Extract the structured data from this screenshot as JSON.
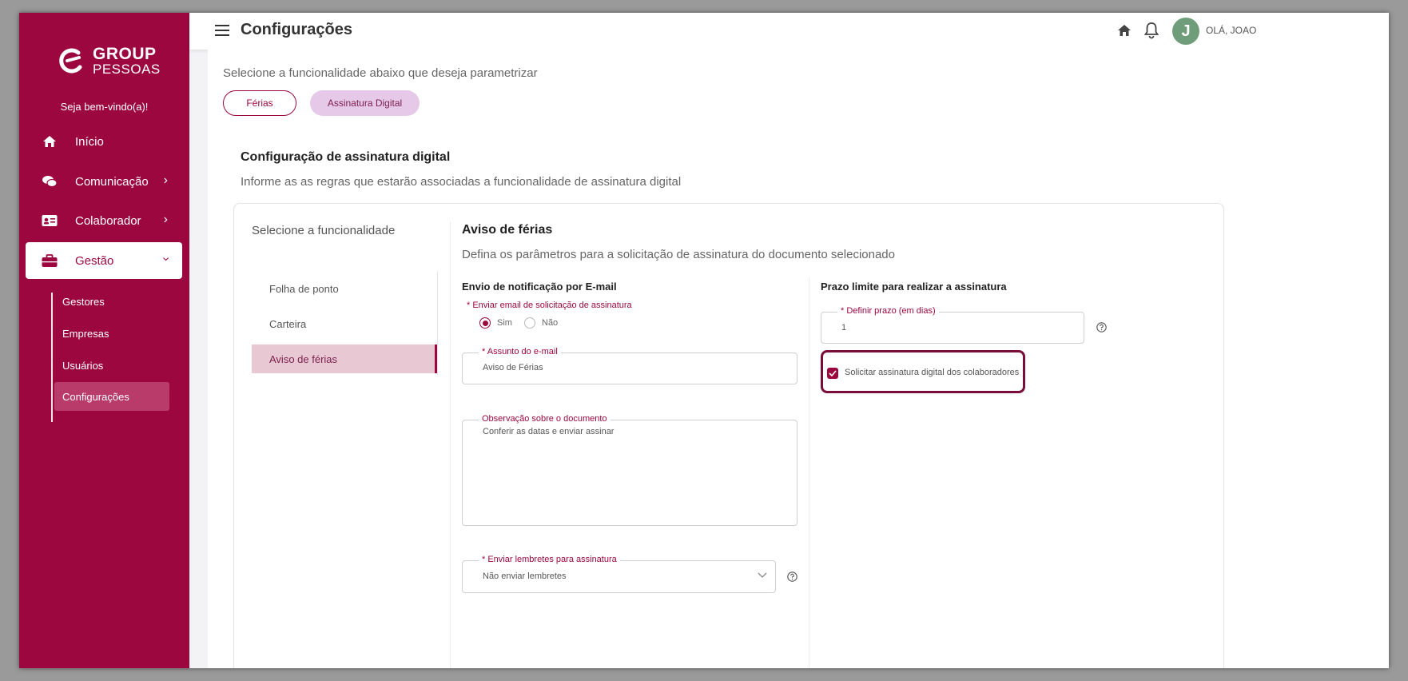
{
  "brand": {
    "line1": "GROUP",
    "line2": "PESSOAS",
    "color": "#9c0740"
  },
  "sidebar": {
    "welcome": "Seja bem-vindo(a)!",
    "items": [
      {
        "label": "Início",
        "icon": "home-icon"
      },
      {
        "label": "Comunicação",
        "icon": "chat-icon"
      },
      {
        "label": "Colaborador",
        "icon": "id-card-icon"
      },
      {
        "label": "Gestão",
        "icon": "briefcase-icon"
      }
    ],
    "subitems": [
      {
        "label": "Gestores"
      },
      {
        "label": "Empresas"
      },
      {
        "label": "Usuários"
      },
      {
        "label": "Configurações"
      }
    ]
  },
  "topbar": {
    "title": "Configurações",
    "avatar_initial": "J",
    "greeting": "OLÁ, JOAO"
  },
  "main": {
    "subtitle": "Selecione a funcionalidade abaixo que deseja parametrizar",
    "pills": [
      "Férias",
      "Assinatura Digital"
    ],
    "section_title": "Configuração de assinatura digital",
    "section_desc": "Informe as as regras que estarão associadas a funcionalidade de assinatura digital",
    "left": {
      "title": "Selecione a funcionalidade",
      "items": [
        "Folha de ponto",
        "Carteira",
        "Aviso de férias"
      ]
    },
    "panel": {
      "title": "Aviso de férias",
      "desc": "Defina os parâmetros para a solicitação de assinatura do documento selecionado",
      "email_group": "Envio de notificação por E-mail",
      "send_email_label": "Enviar email de solicitação de assinatura",
      "radio_yes": "Sim",
      "radio_no": "Não",
      "subject_label": "Assunto do e-mail",
      "subject_value": "Aviso de Férias",
      "obs_label": "Observação sobre o documento",
      "obs_value": "Conferir as datas e enviar assinar",
      "reminder_label": "Enviar lembretes para assinatura",
      "reminder_value": "Não enviar lembretes",
      "deadline_group": "Prazo limite para realizar a assinatura",
      "deadline_label": "Definir prazo (em dias)",
      "deadline_value": "1",
      "checkbox_label": "Solicitar assinatura digital dos colaboradores"
    }
  }
}
